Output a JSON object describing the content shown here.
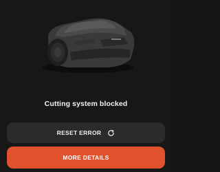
{
  "status": {
    "message": "Cutting system blocked"
  },
  "actions": {
    "reset_label": "RESET ERROR",
    "reset_icon": "refresh-icon",
    "details_label": "MORE DETAILS"
  },
  "image": {
    "subject": "robotic-lawn-mower-icon"
  },
  "colors": {
    "background": "#171717",
    "secondary_button": "#2b2b2b",
    "primary_button": "#e0512d",
    "text": "#ffffff"
  }
}
